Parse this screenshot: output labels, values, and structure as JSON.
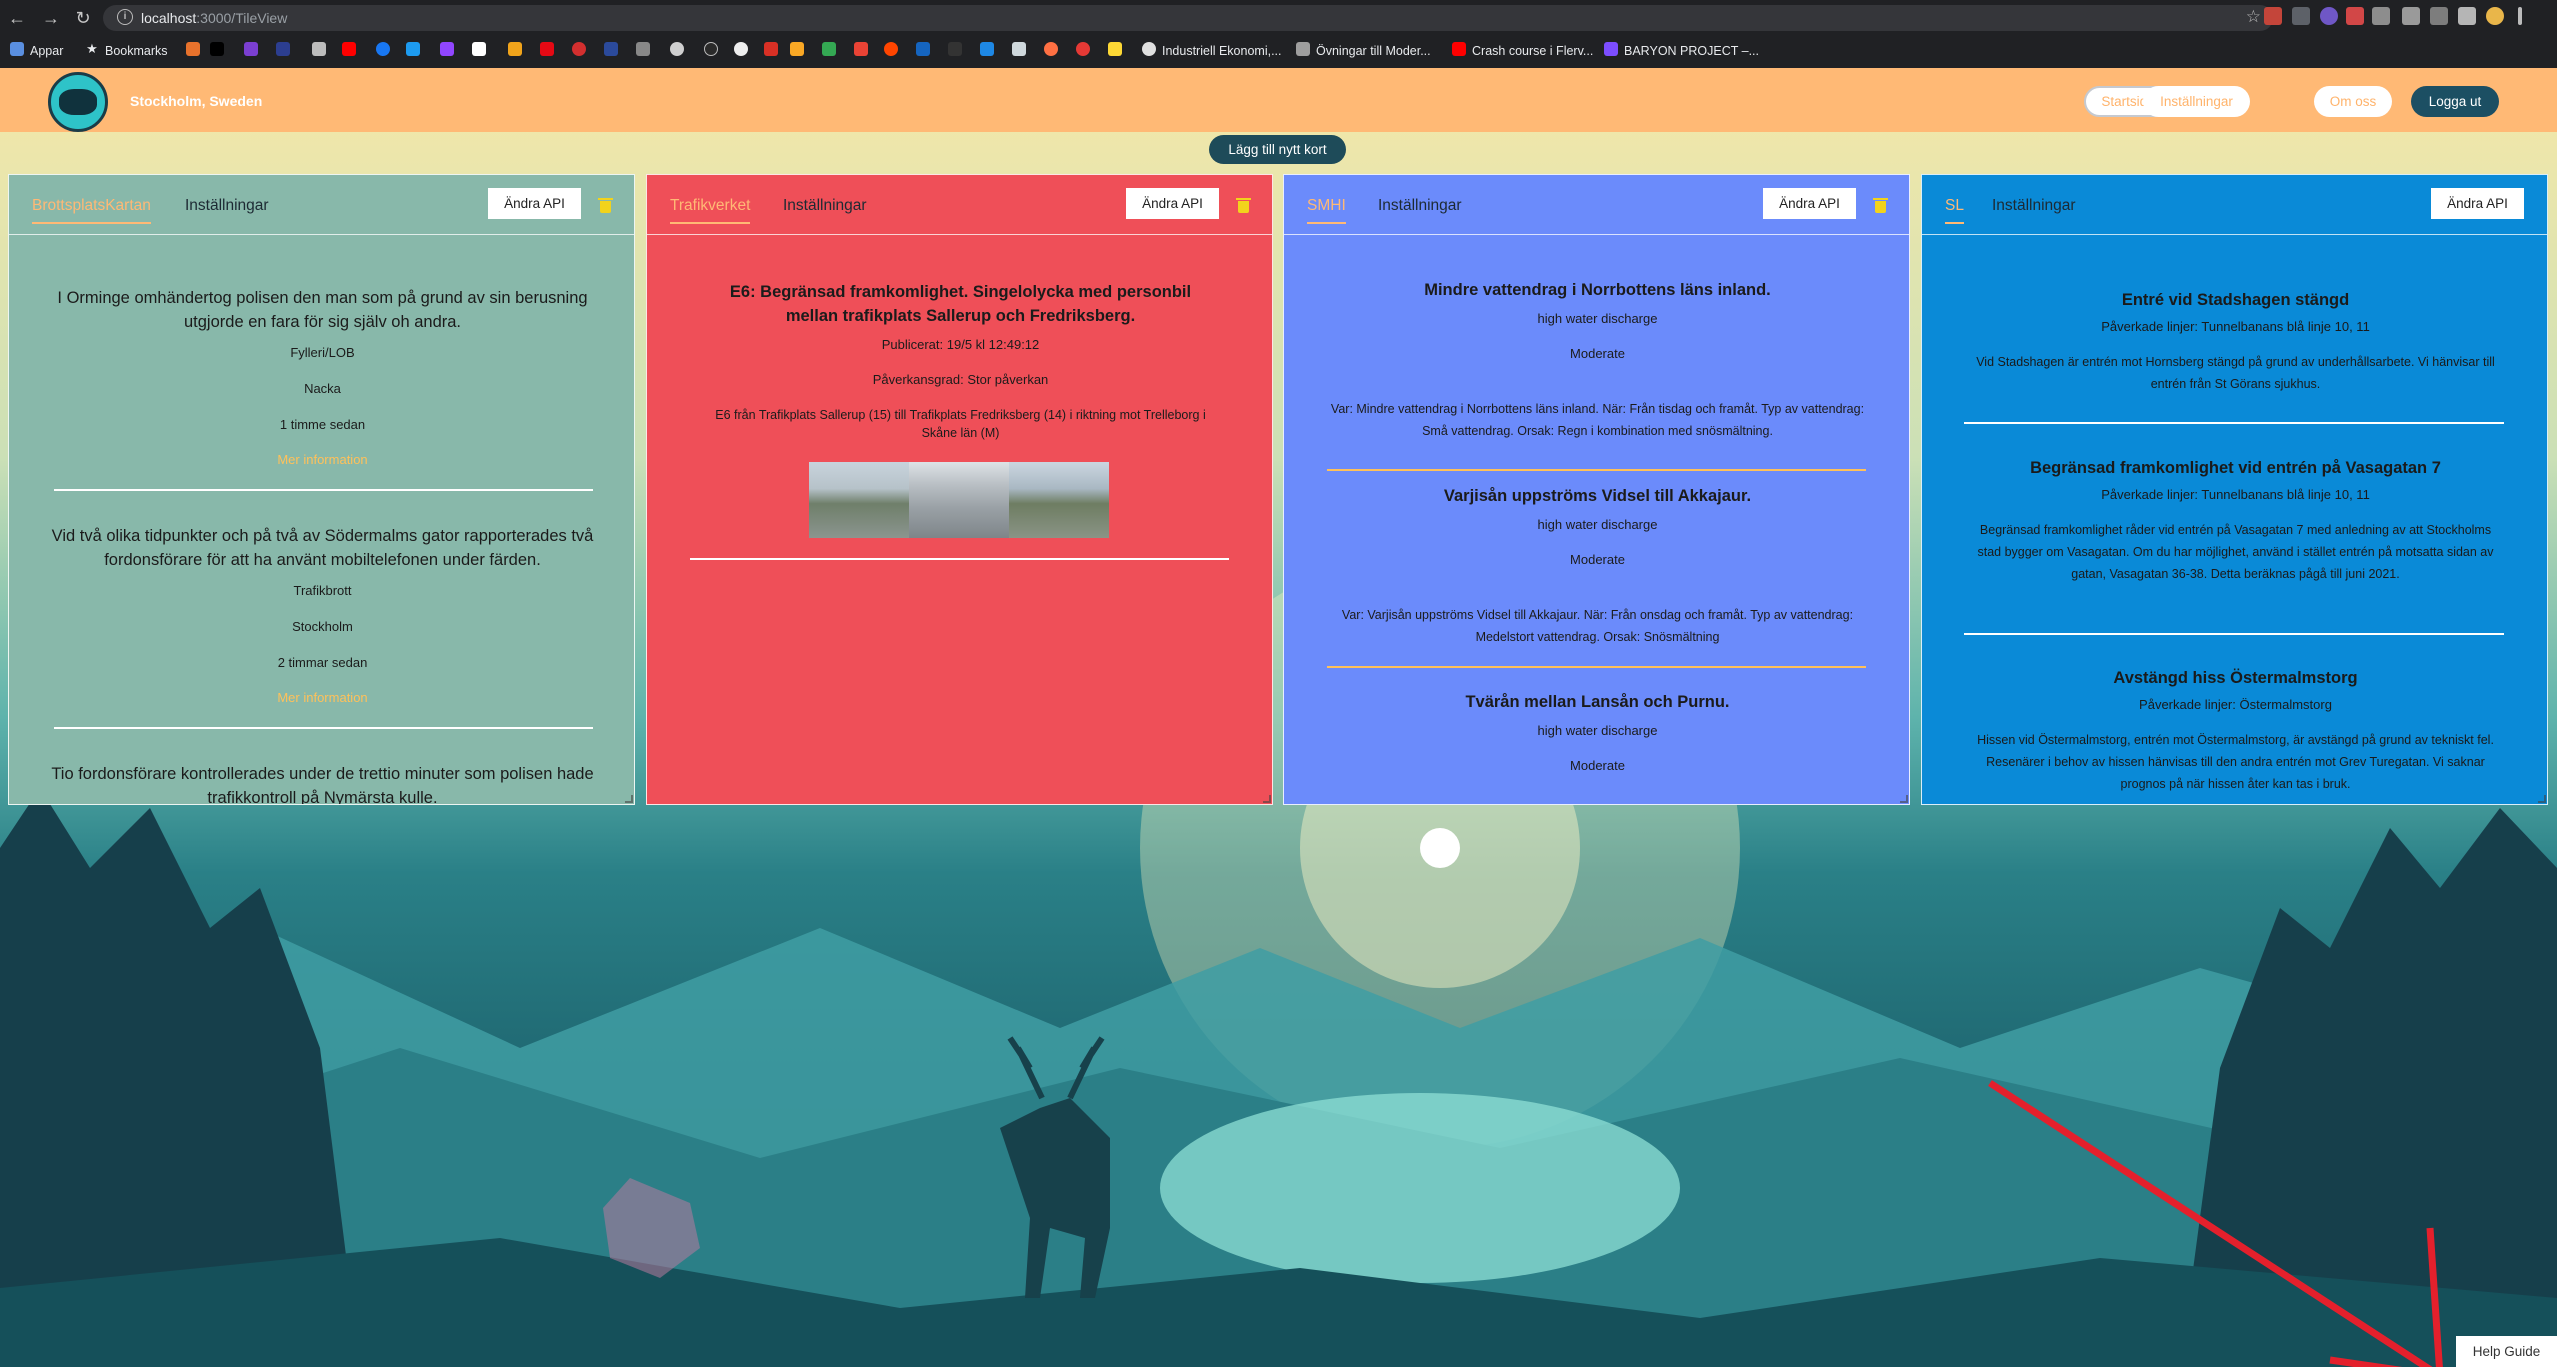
{
  "browser": {
    "url_host": "localhost",
    "url_path": ":3000/TileView",
    "bookmarks": [
      {
        "label": "Appar"
      },
      {
        "label": "Bookmarks"
      },
      {
        "label": "Industriell Ekonomi,..."
      },
      {
        "label": "Övningar till Moder..."
      },
      {
        "label": "Crash course i Flerv..."
      },
      {
        "label": "BARYON PROJECT –..."
      }
    ]
  },
  "header": {
    "city": "Stockholm, Sweden",
    "nav": {
      "home": "Startsida",
      "settings": "Inställningar",
      "about": "Om oss",
      "logout": "Logga ut"
    },
    "add_card": "Lägg till nytt kort"
  },
  "cards": [
    {
      "tab_active": "BrottsplatsKartan",
      "tab_settings": "Inställningar",
      "api_button": "Ändra API",
      "accent": "#88b8aa",
      "entries": [
        {
          "title": "I Orminge omhändertog polisen den man som på grund av sin berusning utgjorde en fara för sig själv oh andra.",
          "category": "Fylleri/LOB",
          "location": "Nacka",
          "time": "1 timme sedan",
          "link": "Mer information"
        },
        {
          "title": "Vid två olika tidpunkter och på två av Södermalms gator rapporterades två fordonsförare för att ha använt mobiltelefonen under färden.",
          "category": "Trafikbrott",
          "location": "Stockholm",
          "time": "2 timmar sedan",
          "link": "Mer information"
        },
        {
          "title": "Tio fordonsförare kontrollerades under de trettio minuter som polisen hade trafikkontroll på Nymärsta kulle."
        }
      ]
    },
    {
      "tab_active": "Trafikverket",
      "tab_settings": "Inställningar",
      "api_button": "Ändra API",
      "accent": "#ef4f58",
      "entry": {
        "title": "E6: Begränsad framkomlighet. Singelolycka med personbil mellan trafikplats Sallerup och Fredriksberg.",
        "published": "Publicerat: 19/5 kl 12:49:12",
        "impact": "Påverkansgrad: Stor påverkan",
        "description": "E6 från Trafikplats Sallerup (15) till Trafikplats Fredriksberg (14) i riktning mot Trelleborg i Skåne län (M)"
      }
    },
    {
      "tab_active": "SMHI",
      "tab_settings": "Inställningar",
      "api_button": "Ändra API",
      "accent": "#6b8bfb",
      "entries": [
        {
          "title": "Mindre vattendrag i Norrbottens läns inland.",
          "type": "high water discharge",
          "level": "Moderate",
          "details": "Var: Mindre vattendrag i Norrbottens läns inland. När: Från tisdag och framåt. Typ av vattendrag: Små vattendrag. Orsak: Regn i kombination med snösmältning."
        },
        {
          "title": "Varjisån uppströms Vidsel till Akkajaur.",
          "type": "high water discharge",
          "level": "Moderate",
          "details": "Var: Varjisån uppströms Vidsel till Akkajaur. När: Från onsdag och framåt. Typ av vattendrag: Medelstort vattendrag. Orsak: Snösmältning"
        },
        {
          "title": "Tvärån mellan Lansån och Purnu.",
          "type": "high water discharge",
          "level": "Moderate"
        }
      ]
    },
    {
      "tab_active": "SL",
      "tab_settings": "Inställningar",
      "api_button": "Ändra API",
      "accent": "#0a8ad7",
      "entries": [
        {
          "title": "Entré vid Stadshagen stängd",
          "lines": "Påverkade linjer: Tunnelbanans blå linje 10, 11",
          "details": "Vid Stadshagen är entrén mot Hornsberg stängd på grund av underhållsarbete. Vi hänvisar till entrén från St Görans sjukhus."
        },
        {
          "title": "Begränsad framkomlighet vid entrén på Vasagatan 7",
          "lines": "Påverkade linjer: Tunnelbanans blå linje 10, 11",
          "details": "Begränsad framkomlighet råder vid entrén på Vasagatan 7 med anledning av att Stockholms stad bygger om Vasagatan. Om du har möjlighet, använd i stället entrén på motsatta sidan av gatan, Vasagatan 36-38. Detta beräknas pågå till juni 2021."
        },
        {
          "title": "Avstängd hiss Östermalmstorg",
          "lines": "Påverkade linjer: Östermalmstorg",
          "details": "Hissen vid Östermalmstorg, entrén mot Östermalmstorg, är avstängd på grund av tekniskt fel. Resenärer i behov av hissen hänvisas till den andra entrén mot Grev Turegatan. Vi saknar prognos på när hissen åter kan tas i bruk."
        }
      ]
    }
  ],
  "help_guide": "Help Guide"
}
